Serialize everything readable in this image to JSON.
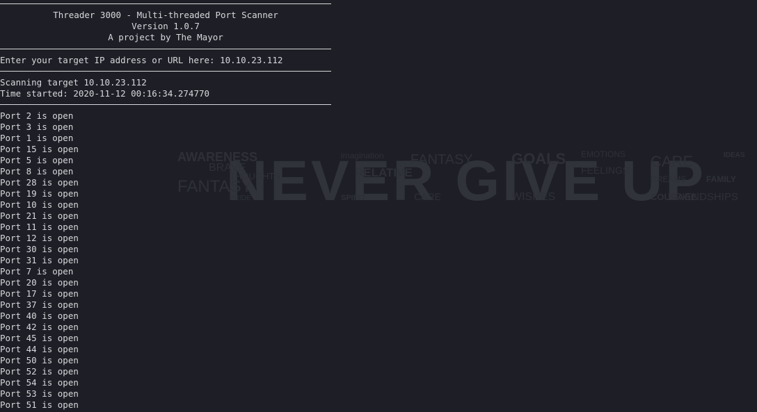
{
  "banner": {
    "title": "Threader 3000 - Multi-threaded Port Scanner",
    "version": "Version 1.0.7",
    "author": "A project by The Mayor"
  },
  "prompt": {
    "label": "Enter your target IP address or URL here: ",
    "value": "10.10.23.112"
  },
  "scan": {
    "target_line": "Scanning target 10.10.23.112",
    "time_line": "Time started: 2020-11-12 00:16:34.274770"
  },
  "ports": [
    "Port 2 is open",
    "Port 3 is open",
    "Port 1 is open",
    "Port 15 is open",
    "Port 5 is open",
    "Port 8 is open",
    "Port 28 is open",
    "Port 19 is open",
    "Port 10 is open",
    "Port 21 is open",
    "Port 11 is open",
    "Port 12 is open",
    "Port 30 is open",
    "Port 31 is open",
    "Port 7 is open",
    "Port 20 is open",
    "Port 17 is open",
    "Port 37 is open",
    "Port 40 is open",
    "Port 42 is open",
    "Port 45 is open",
    "Port 44 is open",
    "Port 50 is open",
    "Port 52 is open",
    "Port 54 is open",
    "Port 53 is open",
    "Port 51 is open"
  ],
  "wallpaper": {
    "headline": "NEVER GIVE UP",
    "words": [
      "AWARENESS",
      "imagination",
      "FANTASY",
      "GOALS",
      "EMOTIONS",
      "CARE",
      "IDEAS",
      "BRAVE",
      "THOUGHTS",
      "RELATIVE",
      "FEELINGS",
      "DREAMS",
      "FAMILY",
      "FANTASY",
      "PRIDE",
      "SPIRIT",
      "CARE",
      "WISHES",
      "COURAGE",
      "FRIENDSHIPS"
    ],
    "colors": {
      "background": "#1e1f26",
      "text": "#2e3038",
      "headline": "#31333b"
    }
  }
}
